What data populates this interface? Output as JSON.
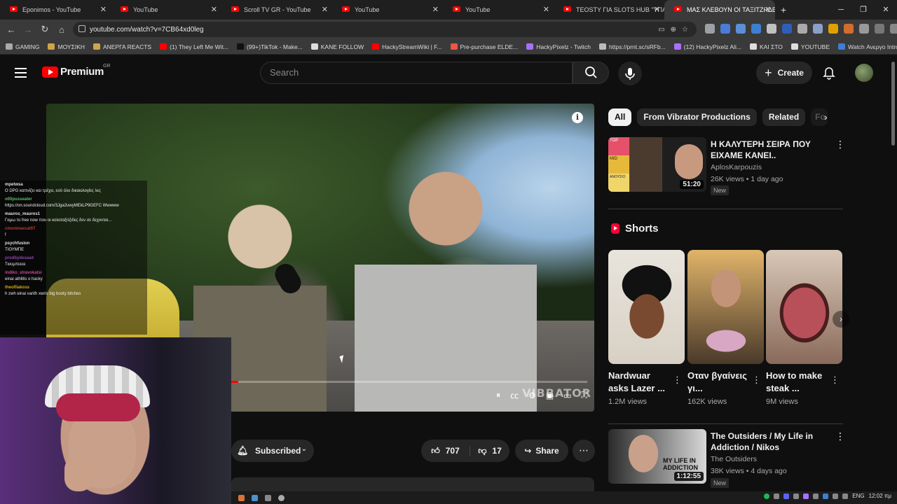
{
  "browser": {
    "tabs": [
      {
        "title": "Eponimos - YouTube",
        "active": false
      },
      {
        "title": "YouTube",
        "active": false
      },
      {
        "title": "Scroll TV GR - YouTube",
        "active": false
      },
      {
        "title": "YouTube",
        "active": false
      },
      {
        "title": "YouTube",
        "active": false
      },
      {
        "title": "TEOSTY ΓΙΑ SLOTS HUB \"ΥΠΑΡ",
        "active": false
      },
      {
        "title": "ΜΑΣ ΚΛΕΒΟΥΝ ΟΙ ΤΑΞΙΤΖΗΔΕ",
        "active": true
      }
    ],
    "url": "youtube.com/watch?v=7CB64xd0leg",
    "bookmarks": [
      "GAMING",
      "ΜΟΥΣΙΚΗ",
      "ΑΝΕΡΓΑ REACTS",
      "(1) They Left Me Wit...",
      "(99+)TikTok - Make...",
      "KANE FOLLOW",
      "HackyStreamWiki | F...",
      "Pre-purchase ELDE...",
      "HackyPixelz - Twitch",
      "https://prnt.sc/sRFb...",
      "(12) HackyPixelz Ali...",
      "ΚΑΙ ΣΤΟ",
      "YOUTUBE",
      "Watch Ανεργο Intro..."
    ],
    "colors": {
      "tabbar": "#1f1f1f",
      "toolbar": "#3a3a3a"
    }
  },
  "youtube": {
    "logo_text": "Premium",
    "region": "GR",
    "search_placeholder": "Search",
    "create_label": "Create"
  },
  "video": {
    "watermark": "VIBRATOR",
    "progress": 0.02
  },
  "chat": [
    {
      "user": "mpetwsa",
      "color": "#e0e0e0",
      "text": "Ο DPG καπνίζει και τρέχει, εσύ όλο δικαιολογίες λες"
    },
    {
      "user": "o00pusseater",
      "color": "#5fbf5f",
      "text": "https://on.soundcloud.com/3Jga2uwyMEkLP9GEFC Wwwww"
    },
    {
      "user": "mauros_mauros1",
      "color": "#e0e0e0",
      "text": "Γαμω το free now που οι κολοταξιτζιδες δεν σε δεχονται..."
    },
    {
      "user": "cmonmaxcat97",
      "color": "#c0392b",
      "text": "f"
    },
    {
      "user": "psychfusion",
      "color": "#e0e0e0",
      "text": "ΤΙΟΥΜΠΕ"
    },
    {
      "user": "prodbydesaad",
      "color": "#8e44ad",
      "text": "Τιουμπεεεε"
    },
    {
      "user": "indiko_stravokatsi",
      "color": "#d1449b",
      "text": "einai athlitis o hacky"
    },
    {
      "user": "theofilakoss",
      "color": "#d4ac0d",
      "text": "h zwh einai varith xwris big booty bitches"
    }
  ],
  "actions": {
    "subscribed_label": "Subscribed",
    "likes": "707",
    "dislikes": "17",
    "share_label": "Share"
  },
  "sidebar": {
    "chips": [
      "All",
      "From Vibrator Productions",
      "Related",
      "Fo"
    ],
    "recs": [
      {
        "title": "Η ΚΑΛΥΤΕΡΗ ΣΕΙΡΑ ΠΟΥ ΕΙΧΑΜΕ ΚΑΝΕΙ..",
        "channel": "AplosKarpouzis",
        "meta": "26K views • 1 day ago",
        "badge": "New",
        "duration": "51:20",
        "tier_labels": [
          "TOP",
          "MID",
          "ΑΝΟΥΣΙΟ"
        ]
      },
      {
        "title": "The Outsiders / My Life in Addiction / Nikos",
        "channel": "The Outsiders",
        "meta": "38K views • 4 days ago",
        "badge": "New",
        "duration": "1:12:55",
        "thumb_text": "MY LIFE IN ADDICTION"
      }
    ],
    "shorts_heading": "Shorts",
    "shorts": [
      {
        "title": "Nardwuar asks Lazer ...",
        "views": "1.2M views"
      },
      {
        "title": "Οταν βγαίνεις γι...",
        "views": "162K views"
      },
      {
        "title": "How to make steak ...",
        "views": "9M views"
      }
    ]
  },
  "taskbar": {
    "lang": "ENG",
    "time": "12:02 πμ"
  }
}
